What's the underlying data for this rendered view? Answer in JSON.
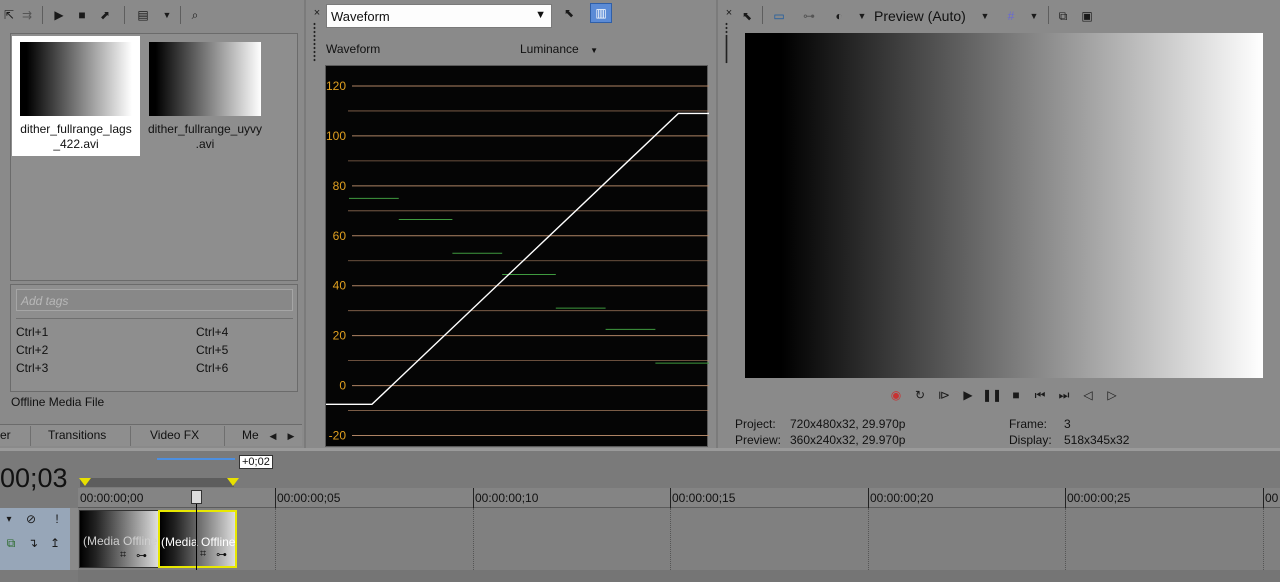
{
  "media": {
    "items": [
      {
        "name": "dither_fullrange_lags\n_422.avi",
        "line1": "dither_fullrange_lags",
        "line2": "_422.avi",
        "selected": true
      },
      {
        "name": "dither_fullrange_uyvy\n.avi",
        "line1": "dither_fullrange_uyvy",
        "line2": ".avi",
        "selected": false
      }
    ],
    "tags_placeholder": "Add tags",
    "shortcuts": [
      "Ctrl+1",
      "Ctrl+2",
      "Ctrl+3",
      "Ctrl+4",
      "Ctrl+5",
      "Ctrl+6"
    ],
    "status": "Offline Media File",
    "tabs": [
      "er",
      "Transitions",
      "Video FX",
      "Me"
    ]
  },
  "scope": {
    "type_selected": "Waveform",
    "title": "Waveform",
    "mode": "Luminance",
    "y_ticks": [
      "120",
      "100",
      "80",
      "60",
      "40",
      "20",
      "0",
      "-20"
    ]
  },
  "chart_data": {
    "type": "line",
    "title": "Waveform",
    "ylabel": "",
    "xlabel": "",
    "ylim": [
      -25,
      128
    ],
    "y_ticks": [
      120,
      100,
      80,
      60,
      40,
      20,
      0,
      -20
    ],
    "series": [
      {
        "values_x": [
          0,
          0.12,
          0.92,
          1.0
        ],
        "values_y": [
          -7.5,
          -7.5,
          109,
          109
        ],
        "color": "#ffffff"
      }
    ],
    "markers": [
      {
        "x0": 0.06,
        "x1": 0.19,
        "y": 75,
        "color": "#3f9a3f"
      },
      {
        "x0": 0.19,
        "x1": 0.33,
        "y": 66.5,
        "color": "#3f9a3f"
      },
      {
        "x0": 0.33,
        "x1": 0.46,
        "y": 53,
        "color": "#3f9a3f"
      },
      {
        "x0": 0.46,
        "x1": 0.6,
        "y": 44.5,
        "color": "#3f9a3f"
      },
      {
        "x0": 0.6,
        "x1": 0.73,
        "y": 31,
        "color": "#3f9a3f"
      },
      {
        "x0": 0.73,
        "x1": 0.86,
        "y": 22.5,
        "color": "#3f9a3f"
      },
      {
        "x0": 0.86,
        "x1": 1.0,
        "y": 9,
        "color": "#3f9a3f"
      }
    ],
    "grid_color": "#b88a6a",
    "tick_color": "#e0a020"
  },
  "preview": {
    "quality": "Preview (Auto)",
    "project_label": "Project:",
    "project_value": "720x480x32, 29.970p",
    "preview_label": "Preview:",
    "preview_value": "360x240x32, 29.970p",
    "frame_label": "Frame:",
    "frame_value": "3",
    "display_label": "Display:",
    "display_value": "518x345x32"
  },
  "timeline": {
    "timecode": "00;03",
    "offset": "+0;02",
    "ruler": [
      "00:00:00;00",
      "00:00:00;05",
      "00:00:00;10",
      "00:00:00;15",
      "00:00:00;20",
      "00:00:00;25",
      "00"
    ],
    "clip_label": "(Media Offline)"
  },
  "colors": {
    "panel": "#8a8a8a",
    "scope_bg": "#050505",
    "grid": "#b88a6a",
    "tick": "#e0a020",
    "clip_border": "#e8e800",
    "track_header": "#97a6b8"
  }
}
